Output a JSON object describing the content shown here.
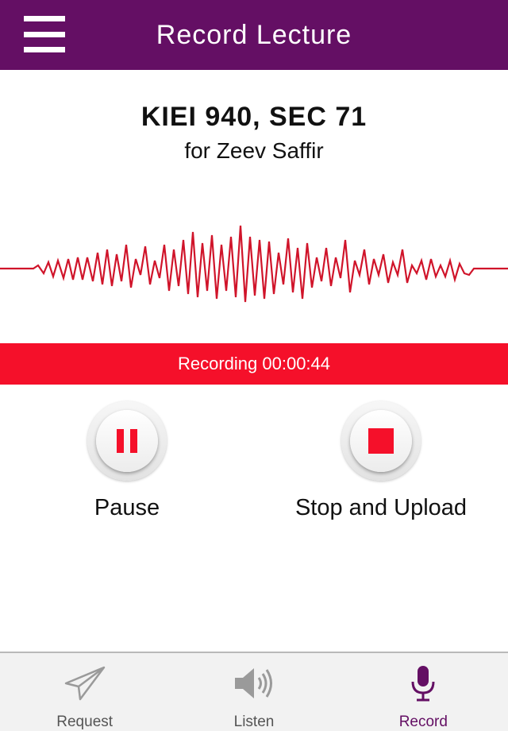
{
  "header": {
    "title": "Record Lecture"
  },
  "course": {
    "code": "KIEI 940, SEC 71",
    "instructor": "for Zeev Saffir"
  },
  "recording": {
    "status": "Recording 00:00:44"
  },
  "controls": {
    "pause_label": "Pause",
    "stop_label": "Stop and Upload"
  },
  "tabs": [
    {
      "label": "Request",
      "icon": "paper-plane-icon",
      "active": false
    },
    {
      "label": "Listen",
      "icon": "speaker-icon",
      "active": false
    },
    {
      "label": "Record",
      "icon": "microphone-icon",
      "active": true
    }
  ],
  "colors": {
    "nav_purple": "#640f64",
    "recording_red": "#f5102a",
    "waveform_red": "#d0142a",
    "active_tab": "#640f64"
  }
}
